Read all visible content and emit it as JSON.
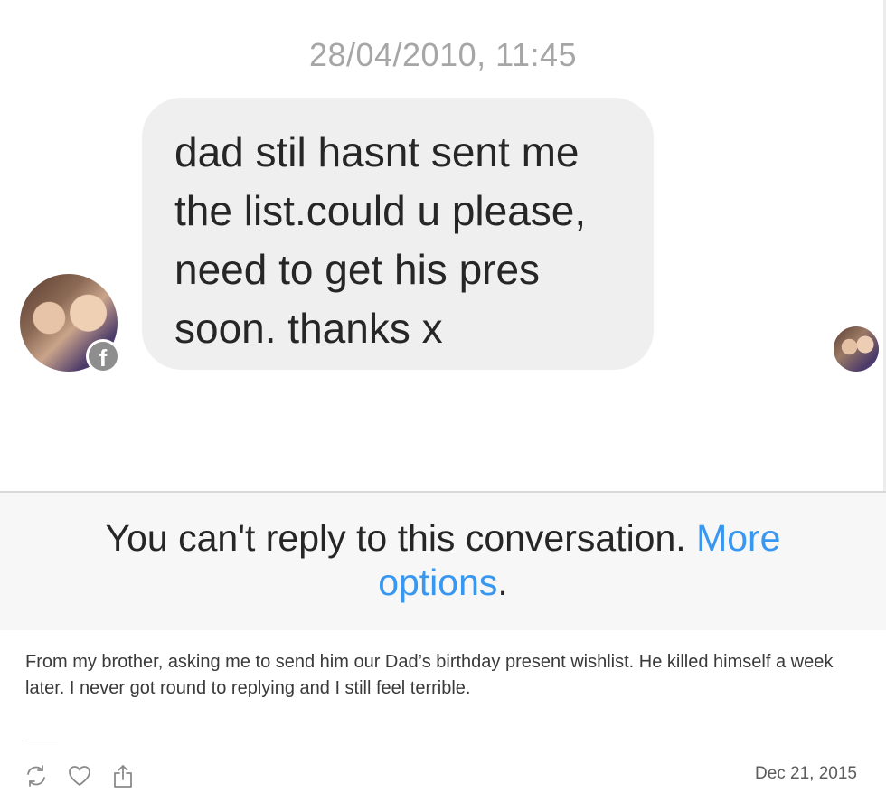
{
  "conversation": {
    "timestamp": "28/04/2010, 11:45",
    "message_lines": [
      "dad stil hasnt sent me",
      "the list.could u please,",
      "need to get his pres",
      "soon. thanks x"
    ],
    "badge_glyph": "f"
  },
  "notice": {
    "text": "You can't reply to this conversation.",
    "link_line1": "More",
    "link_line2": "options",
    "period": "."
  },
  "post": {
    "caption": "From my brother, asking me to send him our Dad’s birthday present wishlist. He killed himself a week later. I never got round to replying and I still feel terrible.",
    "date": "Dec 21, 2015"
  },
  "icons": {
    "avatar": "profile-photo",
    "badge": "facebook-icon",
    "actions": [
      "repost-icon",
      "heart-icon",
      "share-icon"
    ]
  },
  "colors": {
    "bubble": "#efefef",
    "link": "#3897f0",
    "timestamp": "#a6a6a6",
    "notice_bg": "#f7f7f7"
  }
}
